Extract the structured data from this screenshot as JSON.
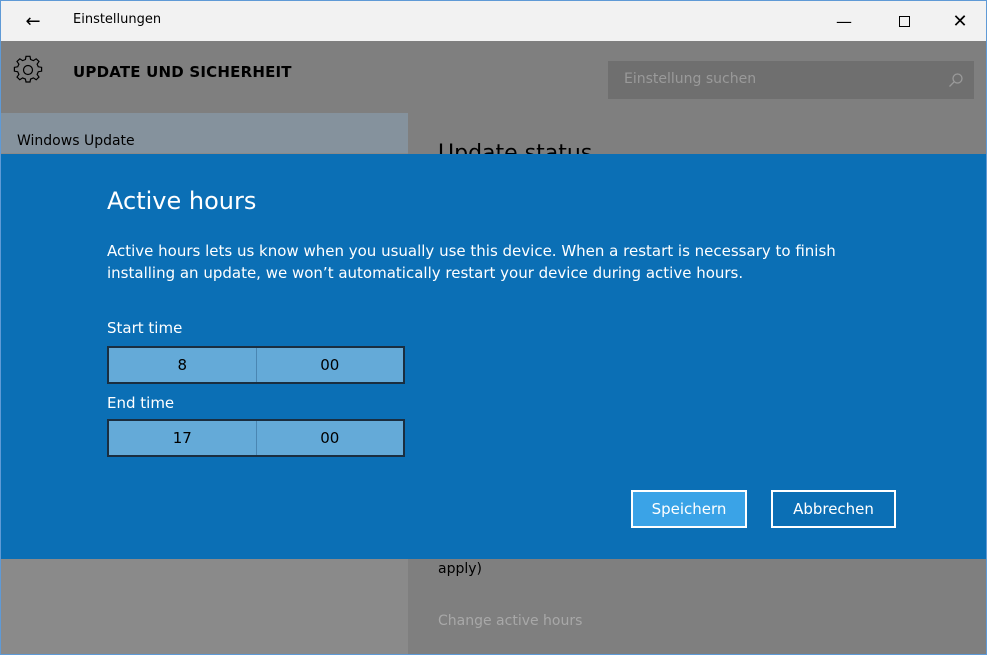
{
  "window": {
    "title": "Einstellungen",
    "back_icon": "back-arrow-icon",
    "minimize_glyph": "—",
    "close_glyph": "✕"
  },
  "header": {
    "section_title": "UPDATE UND SICHERHEIT",
    "icon": "gear-icon",
    "search": {
      "placeholder": "Einstellung suchen",
      "icon": "search-icon"
    }
  },
  "sidebar": {
    "items": [
      {
        "label": "Windows Update",
        "selected": true
      }
    ]
  },
  "main": {
    "heading": "Update status",
    "apply_text": "apply)",
    "change_active_hours_link": "Change active hours"
  },
  "dialog": {
    "title": "Active hours",
    "description": "Active hours lets us know when you usually use this device. When a restart is necessary to finish installing an update, we won’t automatically restart your device during active hours.",
    "start": {
      "label": "Start time",
      "hour": "8",
      "minute": "00"
    },
    "end": {
      "label": "End time",
      "hour": "17",
      "minute": "00"
    },
    "save_label": "Speichern",
    "cancel_label": "Abbrechen"
  },
  "colors": {
    "accent": "#0b6fb5",
    "save_button": "#3aa3e7",
    "picker_fill": "#64aad8"
  }
}
